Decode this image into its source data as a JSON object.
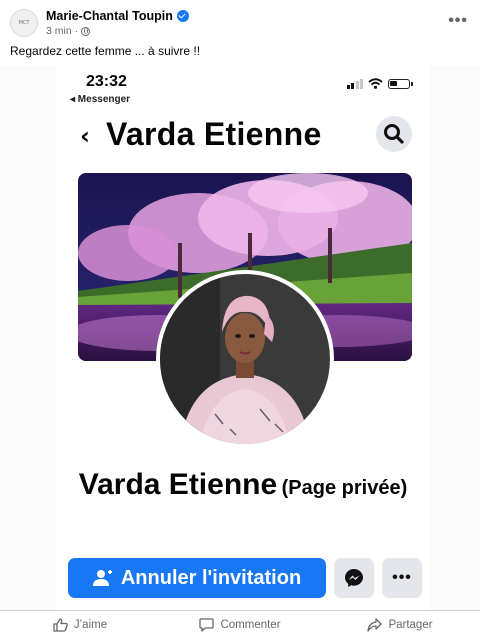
{
  "post": {
    "author": "Marie-Chantal Toupin",
    "avatar_text": "MCT",
    "time": "3 min",
    "privacy_icon": "globe-icon",
    "caption": "Regardez cette femme ... à suivre !!"
  },
  "screenshot": {
    "status_time": "23:32",
    "back_app": "◂ Messenger",
    "nav_title": "Varda Etienne",
    "profile_name": "Varda Etienne",
    "profile_suffix": "(Page privée)",
    "primary_button": "Annuler l'invitation",
    "primary_button_icon": "person-add-icon",
    "messenger_icon": "messenger-icon",
    "more_label": "•••",
    "colors": {
      "primary": "#1877f2",
      "button_gray": "#e4e6eb"
    }
  },
  "actions": [
    {
      "label": "J’aime",
      "icon": "thumbs-up-icon"
    },
    {
      "label": "Commenter",
      "icon": "comment-icon"
    },
    {
      "label": "Partager",
      "icon": "share-icon"
    }
  ]
}
